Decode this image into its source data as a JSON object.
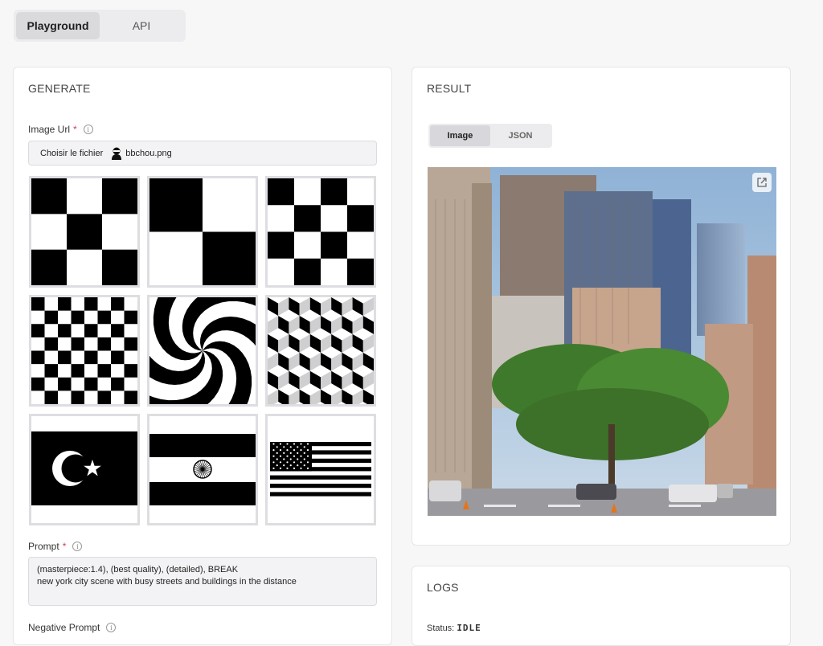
{
  "top_tabs": [
    {
      "label": "Playground"
    },
    {
      "label": "API"
    }
  ],
  "generate": {
    "title": "GENERATE",
    "image_url": {
      "label": "Image Url",
      "required": "*",
      "info": "i",
      "button_label": "Choisir le fichier",
      "file_name": "bbchou.png"
    },
    "prompt": {
      "label": "Prompt",
      "required": "*",
      "info": "i",
      "value": "(masterpiece:1.4), (best quality), (detailed), BREAK\nnew york city scene with busy streets and buildings in the distance"
    },
    "negative_prompt": {
      "label": "Negative Prompt",
      "info": "i"
    },
    "presets": [
      {
        "name": "checker-3x3"
      },
      {
        "name": "checker-2x2"
      },
      {
        "name": "checker-4x4"
      },
      {
        "name": "checker-8x8"
      },
      {
        "name": "spiral"
      },
      {
        "name": "isometric-cubes"
      },
      {
        "name": "flag-crescent-star"
      },
      {
        "name": "flag-chakra"
      },
      {
        "name": "flag-stars-stripes"
      }
    ]
  },
  "result": {
    "title": "RESULT",
    "tabs": [
      {
        "label": "Image"
      },
      {
        "label": "JSON"
      }
    ]
  },
  "logs": {
    "title": "LOGS",
    "status_label": "Status:",
    "status_value": "IDLE"
  },
  "colors": {
    "accent_required": "#d43a5e",
    "sky": "#a9c4dd"
  }
}
